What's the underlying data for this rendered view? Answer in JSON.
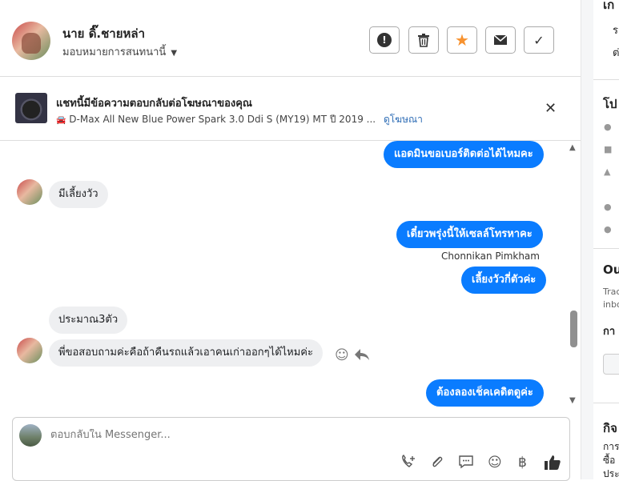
{
  "header": {
    "name": "นาย ดิ๊.ชายหล่า",
    "assign_label": "มอบหมายการสนทนานี้",
    "buttons": {
      "spam": "!",
      "delete": "🗑",
      "star": "★",
      "mark_unread": "✉",
      "done": "✓"
    },
    "star_color": "#f7922f"
  },
  "ad": {
    "title": "แชทนี้มีข้อความตอบกลับต่อโฆษณาของคุณ",
    "subtitle": "D-Max All New Blue Power Spark 3.0 Ddi S (MY19) MT ปี 2019 ...",
    "link": "ดูโฆษณา",
    "close": "✕"
  },
  "messages": [
    {
      "dir": "out",
      "text": "แอดมินขอเบอร์ติดต่อได้ไหมคะ"
    },
    {
      "dir": "in",
      "text": "มีเลี้ยงวัว"
    },
    {
      "dir": "out",
      "text": "เดี๋ยวพรุ่งนี้ให้เซลล์โทรหาคะ"
    },
    {
      "dir": "sender",
      "text": "Chonnikan Pimkham"
    },
    {
      "dir": "out",
      "text": "เลี้ยงวัวกี่ตัวค่ะ"
    },
    {
      "dir": "in",
      "text": "ประมาณ3ตัว"
    },
    {
      "dir": "in",
      "text": "พี่ขอสอบถามค่ะคือถ้าคืนรถแล้วเอาคนเก่าออกๆได้ไหมค่ะ"
    },
    {
      "dir": "out",
      "text": "ต้องลองเช็คเคดิตดูค่ะ"
    }
  ],
  "composer": {
    "placeholder": "ตอบกลับใน Messenger...",
    "tools": [
      "call-add-icon",
      "attach-icon",
      "saved-reply-icon",
      "emoji-icon",
      "baht-icon",
      "like-icon"
    ]
  },
  "accent_color": "#0a7cff",
  "right_panel": {
    "line1": "เก",
    "line2": "รา",
    "line3": "ต่",
    "section1": "โป",
    "section2": "Ou",
    "trac": "Trac",
    "inbo": "inbo",
    "kan": "กา",
    "section3": "กิจ",
    "kan2": "การ",
    "sue": "ซื้อ",
    "pra": "ประ"
  }
}
